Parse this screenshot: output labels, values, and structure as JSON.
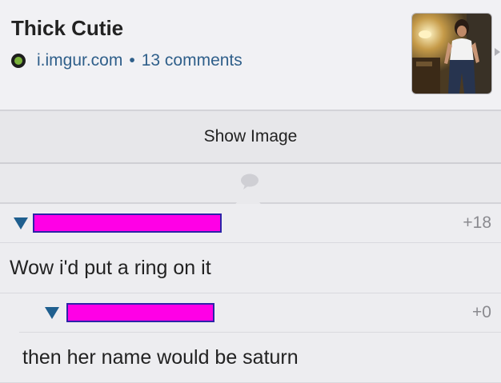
{
  "post": {
    "title": "Thick Cutie",
    "domain": "i.imgur.com",
    "separator": "•",
    "comments_label": "13 comments",
    "domain_icon": "imgur-dot-icon",
    "thumbnail_icon": "post-thumbnail-image"
  },
  "show_image": {
    "label": "Show Image"
  },
  "divider": {
    "icon": "comment-bubble-icon"
  },
  "comments": [
    {
      "username": "",
      "username_redacted": true,
      "score": "+18",
      "text": "Wow i'd put a ring on it"
    },
    {
      "username": "",
      "username_redacted": true,
      "score": "+0",
      "text": "then her name would be saturn"
    }
  ],
  "colors": {
    "link": "#2f5f8a",
    "collapse_arrow": "#1f5f8f",
    "redaction_fill": "#ff00e6",
    "redaction_border": "#2d23a8",
    "background": "#ededf0"
  }
}
